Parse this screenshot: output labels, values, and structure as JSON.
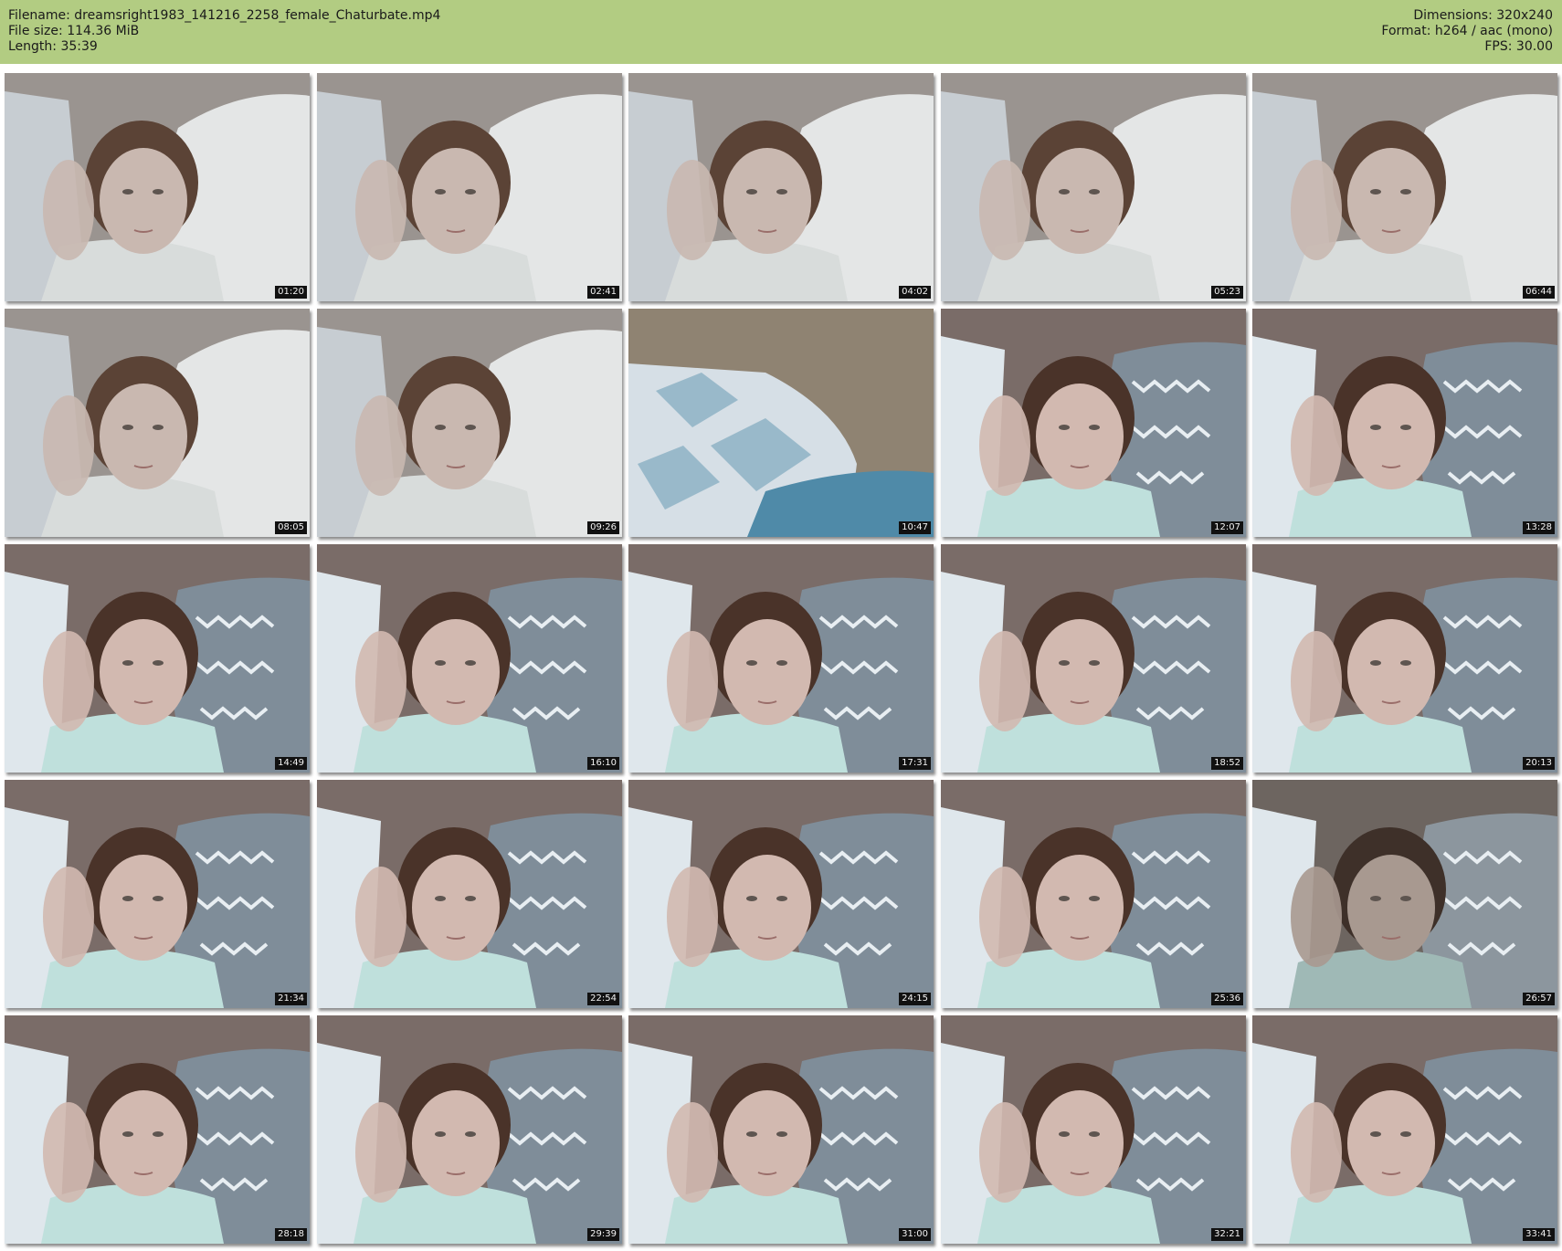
{
  "header": {
    "filename": "Filename: dreamsright1983_141216_2258_female_Chaturbate.mp4",
    "filesize": "File size: 114.36 MiB",
    "length": "Length: 35:39",
    "dimensions": "Dimensions: 320x240",
    "format": "Format: h264 / aac (mono)",
    "fps": "FPS: 30.00",
    "background_color": "#b2cc82"
  },
  "thumbnails": [
    {
      "timestamp": "01:20",
      "scene": "blanket"
    },
    {
      "timestamp": "02:41",
      "scene": "blanket"
    },
    {
      "timestamp": "04:02",
      "scene": "blanket"
    },
    {
      "timestamp": "05:23",
      "scene": "blanket"
    },
    {
      "timestamp": "06:44",
      "scene": "blanket"
    },
    {
      "timestamp": "08:05",
      "scene": "blanket"
    },
    {
      "timestamp": "09:26",
      "scene": "blanket"
    },
    {
      "timestamp": "10:47",
      "scene": "pillow-only"
    },
    {
      "timestamp": "12:07",
      "scene": "pillow"
    },
    {
      "timestamp": "13:28",
      "scene": "pillow"
    },
    {
      "timestamp": "14:49",
      "scene": "pillow"
    },
    {
      "timestamp": "16:10",
      "scene": "pillow"
    },
    {
      "timestamp": "17:31",
      "scene": "pillow"
    },
    {
      "timestamp": "18:52",
      "scene": "pillow"
    },
    {
      "timestamp": "20:13",
      "scene": "pillow"
    },
    {
      "timestamp": "21:34",
      "scene": "pillow"
    },
    {
      "timestamp": "22:54",
      "scene": "pillow"
    },
    {
      "timestamp": "24:15",
      "scene": "pillow"
    },
    {
      "timestamp": "25:36",
      "scene": "pillow"
    },
    {
      "timestamp": "26:57",
      "scene": "pillow-dark"
    },
    {
      "timestamp": "28:18",
      "scene": "pillow"
    },
    {
      "timestamp": "29:39",
      "scene": "pillow"
    },
    {
      "timestamp": "31:00",
      "scene": "pillow"
    },
    {
      "timestamp": "32:21",
      "scene": "pillow"
    },
    {
      "timestamp": "33:41",
      "scene": "pillow"
    }
  ]
}
